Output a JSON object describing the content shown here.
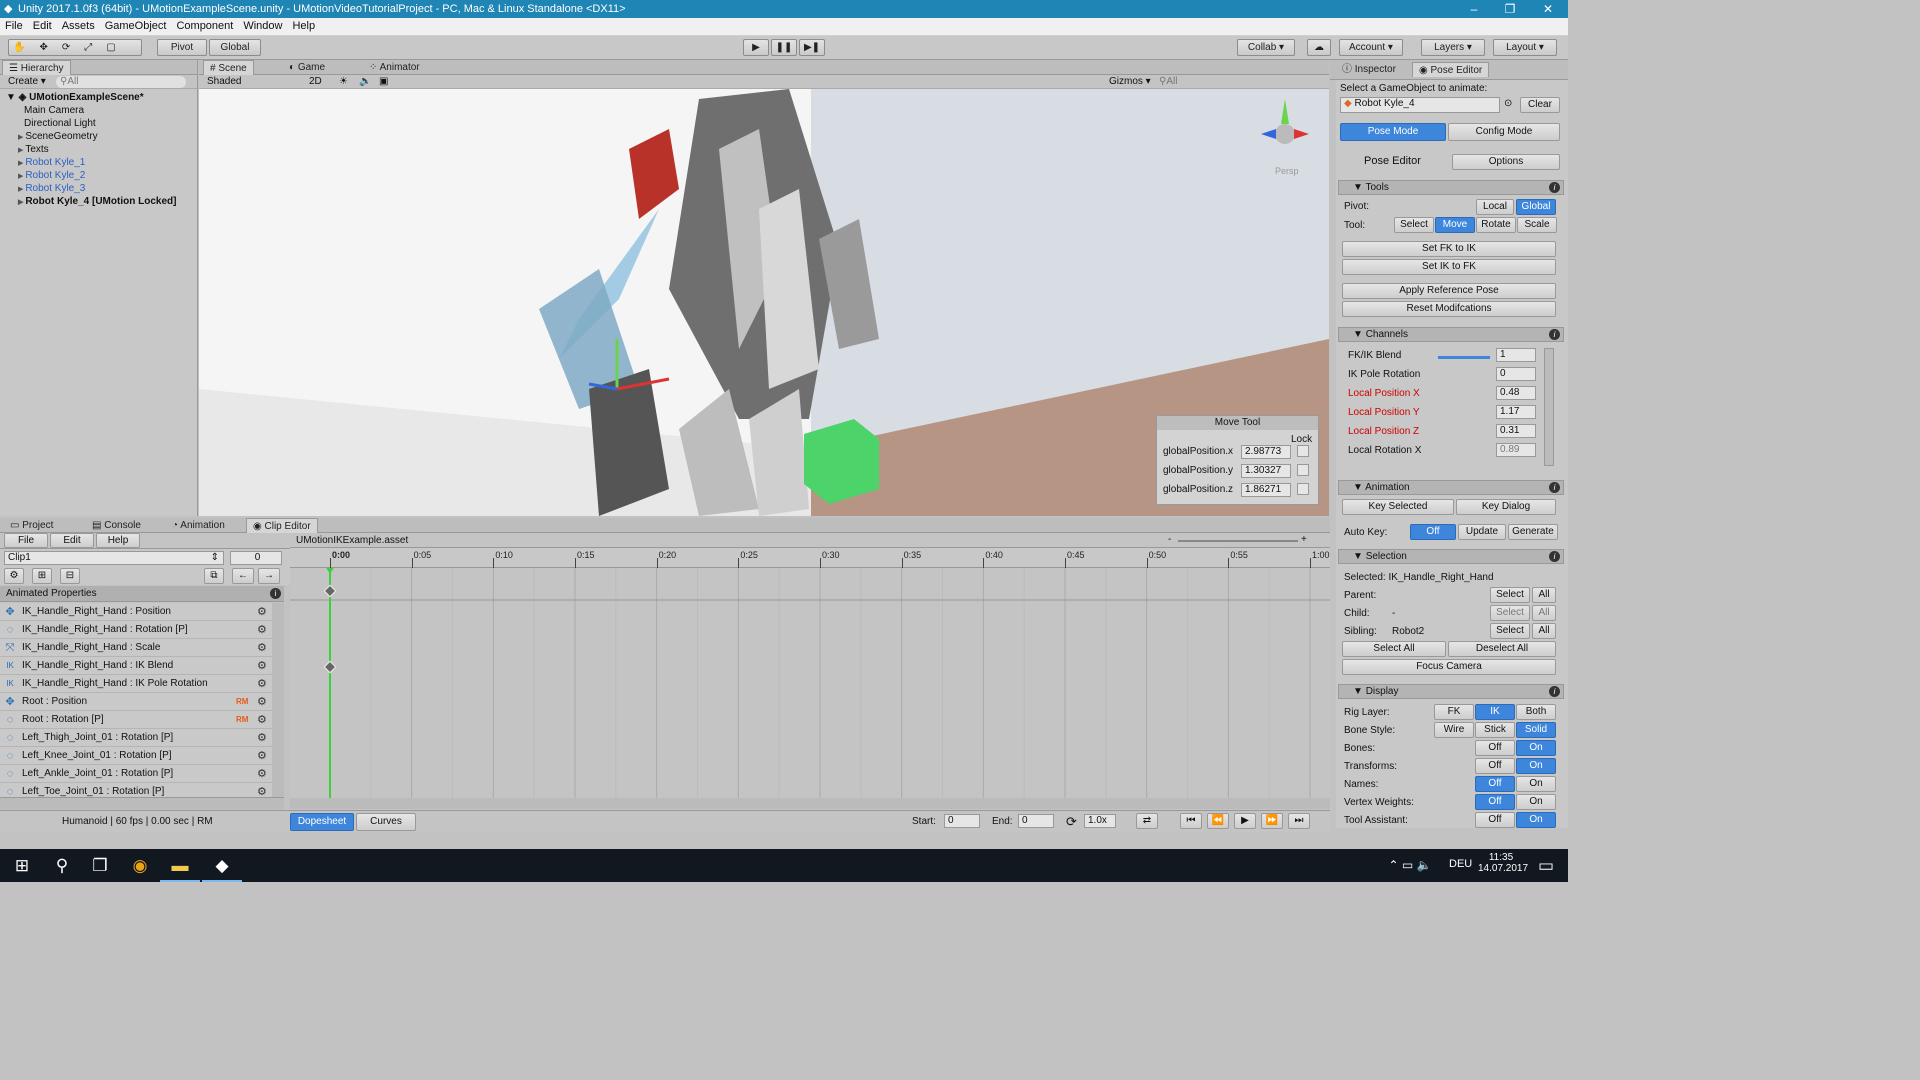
{
  "window": {
    "title": "Unity 2017.1.0f3 (64bit) - UMotionExampleScene.unity - UMotionVideoTutorialProject - PC, Mac & Linux Standalone <DX11>"
  },
  "menu": [
    "File",
    "Edit",
    "Assets",
    "GameObject",
    "Component",
    "Window",
    "Help"
  ],
  "toolbar": {
    "pivot": "Pivot",
    "global": "Global",
    "collab": "Collab",
    "account": "Account",
    "layers": "Layers",
    "layout": "Layout"
  },
  "hierarchy": {
    "tab": "Hierarchy",
    "create": "Create",
    "search": "All",
    "scene": "UMotionExampleScene*",
    "items": [
      "Main Camera",
      "Directional Light",
      "SceneGeometry",
      "Texts",
      "Robot Kyle_1",
      "Robot Kyle_2",
      "Robot Kyle_3",
      "Robot Kyle_4 [UMotion Locked]"
    ]
  },
  "scene": {
    "tabs": [
      "Scene",
      "Game",
      "Animator"
    ],
    "shaded": "Shaded",
    "mode2d": "2D",
    "gizmos": "Gizmos",
    "search": "All",
    "persp": "Persp"
  },
  "movetool": {
    "title": "Move Tool",
    "lock": "Lock",
    "fields": [
      {
        "label": "globalPosition.x",
        "value": "2.98773"
      },
      {
        "label": "globalPosition.y",
        "value": "1.30327"
      },
      {
        "label": "globalPosition.z",
        "value": "1.86271"
      }
    ]
  },
  "bottomtabs": [
    "Project",
    "Console",
    "Animation",
    "Clip Editor"
  ],
  "clipeditor": {
    "menu": [
      "File",
      "Edit",
      "Help"
    ],
    "clip": "Clip1",
    "frame": "0",
    "asset": "UMotionIKExample.asset",
    "animated_properties": "Animated Properties",
    "properties": [
      {
        "name": "IK_Handle_Right_Hand : Position",
        "icon": "move-icon",
        "rm": ""
      },
      {
        "name": "IK_Handle_Right_Hand : Rotation [P]",
        "icon": "rotate-icon",
        "rm": ""
      },
      {
        "name": "IK_Handle_Right_Hand : Scale",
        "icon": "scale-icon",
        "rm": ""
      },
      {
        "name": "IK_Handle_Right_Hand : IK Blend",
        "icon": "ik-icon",
        "rm": ""
      },
      {
        "name": "IK_Handle_Right_Hand : IK Pole Rotation",
        "icon": "ik-icon",
        "rm": ""
      },
      {
        "name": "Root : Position",
        "icon": "move-icon",
        "rm": "RM"
      },
      {
        "name": "Root : Rotation [P]",
        "icon": "rotate-icon",
        "rm": "RM"
      },
      {
        "name": "Left_Thigh_Joint_01 : Rotation [P]",
        "icon": "rotate-icon",
        "rm": ""
      },
      {
        "name": "Left_Knee_Joint_01 : Rotation [P]",
        "icon": "rotate-icon",
        "rm": ""
      },
      {
        "name": "Left_Ankle_Joint_01 : Rotation [P]",
        "icon": "rotate-icon",
        "rm": ""
      },
      {
        "name": "Left_Toe_Joint_01 : Rotation [P]",
        "icon": "rotate-icon",
        "rm": ""
      }
    ],
    "ticks": [
      "0:00",
      "0:05",
      "0:10",
      "0:15",
      "0:20",
      "0:25",
      "0:30",
      "0:35",
      "0:40",
      "0:45",
      "0:50",
      "0:55",
      "1:00"
    ],
    "status": "Humanoid | 60 fps | 0.00 sec | RM",
    "dopesheet": "Dopesheet",
    "curves": "Curves",
    "start_label": "Start:",
    "start": "0",
    "end_label": "End:",
    "end": "0",
    "speed": "1.0x"
  },
  "inspector": {
    "tabs": [
      "Inspector",
      "Pose Editor"
    ],
    "select_label": "Select a GameObject to animate:",
    "object": "Robot Kyle_4",
    "clear": "Clear",
    "pose_mode": "Pose Mode",
    "config_mode": "Config Mode",
    "pose_editor": "Pose Editor",
    "options": "Options",
    "tools": {
      "title": "Tools",
      "pivot": "Pivot:",
      "local": "Local",
      "global": "Global",
      "tool": "Tool:",
      "select": "Select",
      "move": "Move",
      "rotate": "Rotate",
      "scale": "Scale",
      "fk_to_ik": "Set FK to IK",
      "ik_to_fk": "Set IK to FK",
      "apply_ref": "Apply Reference Pose",
      "reset": "Reset Modifcations"
    },
    "channels": {
      "title": "Channels",
      "items": [
        {
          "label": "FK/IK Blend",
          "value": "1",
          "red": false
        },
        {
          "label": "IK Pole Rotation",
          "value": "0",
          "red": false
        },
        {
          "label": "Local Position X",
          "value": "0.48",
          "red": true
        },
        {
          "label": "Local Position Y",
          "value": "1.17",
          "red": true
        },
        {
          "label": "Local Position Z",
          "value": "0.31",
          "red": true
        },
        {
          "label": "Local Rotation X",
          "value": "0.89",
          "red": false
        }
      ],
      "blend": 1
    },
    "animation": {
      "title": "Animation",
      "key_selected": "Key Selected",
      "key_dialog": "Key Dialog",
      "auto_key": "Auto Key:",
      "off": "Off",
      "update": "Update",
      "generate": "Generate"
    },
    "selection": {
      "title": "Selection",
      "selected": "Selected: IK_Handle_Right_Hand",
      "parent": "Parent:",
      "child": "Child:",
      "child_val": "-",
      "sibling": "Sibling:",
      "sibling_val": "Robot2",
      "select": "Select",
      "all": "All",
      "select_all": "Select All",
      "deselect_all": "Deselect All",
      "focus": "Focus Camera"
    },
    "display": {
      "title": "Display",
      "rig_layer": "Rig Layer:",
      "fk": "FK",
      "ik": "IK",
      "both": "Both",
      "bone_style": "Bone Style:",
      "wire": "Wire",
      "stick": "Stick",
      "solid": "Solid",
      "rows": [
        {
          "label": "Bones:",
          "on": true
        },
        {
          "label": "Transforms:",
          "on": true
        },
        {
          "label": "Names:",
          "on": false
        },
        {
          "label": "Vertex Weights:",
          "on": false
        },
        {
          "label": "Tool Assistant:",
          "on": true
        }
      ],
      "off": "Off",
      "on": "On"
    }
  },
  "taskbar": {
    "lang": "DEU",
    "time": "11:35",
    "date": "14.07.2017"
  },
  "colors": {
    "accent": "#3e86db",
    "titlebar": "#1f85b5",
    "keyframe_line": "#3bd13b"
  }
}
